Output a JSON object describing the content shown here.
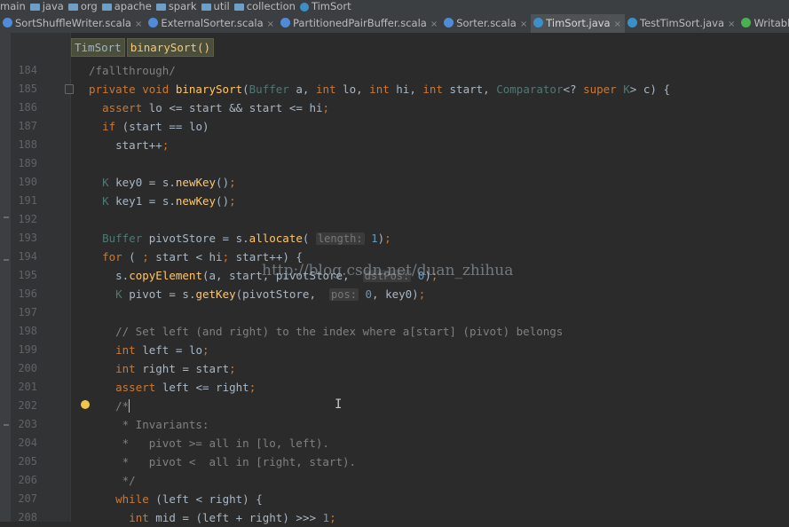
{
  "breadcrumbs": [
    "main",
    "java",
    "org",
    "apache",
    "spark",
    "util",
    "collection",
    "TimSort"
  ],
  "tabs": [
    {
      "label": "SortShuffleWriter.scala",
      "color": "#4f8bd6",
      "active": false
    },
    {
      "label": "ExternalSorter.scala",
      "color": "#4f8bd6",
      "active": false
    },
    {
      "label": "PartitionedPairBuffer.scala",
      "color": "#4f8bd6",
      "active": false
    },
    {
      "label": "Sorter.scala",
      "color": "#4f8bd6",
      "active": false
    },
    {
      "label": "TimSort.java",
      "color": "#3d8fc9",
      "active": true
    },
    {
      "label": "TestTimSort.java",
      "color": "#3d8fc9",
      "active": false
    },
    {
      "label": "WritablePa",
      "color": "#4caf50",
      "active": false
    }
  ],
  "tab_close_glyph": "×",
  "code_breadcrumb": {
    "class_name": "TimSort",
    "method_name": "binarySort()"
  },
  "watermark": "http://blog.csdn.net/duan_zhihua",
  "ibeam_glyph": "I",
  "lines": [
    {
      "num": "184",
      "text": "/fallthrough/"
    },
    {
      "num": "185",
      "text": "private void binarySort(Buffer a, int lo, int hi, int start, Comparator<? super K> c) {"
    },
    {
      "num": "186",
      "text": "  assert lo <= start && start <= hi;"
    },
    {
      "num": "187",
      "text": "  if (start == lo)"
    },
    {
      "num": "188",
      "text": "    start++;"
    },
    {
      "num": "189",
      "text": ""
    },
    {
      "num": "190",
      "text": "  K key0 = s.newKey();"
    },
    {
      "num": "191",
      "text": "  K key1 = s.newKey();"
    },
    {
      "num": "192",
      "text": ""
    },
    {
      "num": "193",
      "text": "  Buffer pivotStore = s.allocate( length: 1);"
    },
    {
      "num": "194",
      "text": "  for ( ; start < hi; start++) {"
    },
    {
      "num": "195",
      "text": "    s.copyElement(a, start, pivotStore,  dstPos: 0);"
    },
    {
      "num": "196",
      "text": "    K pivot = s.getKey(pivotStore,  pos: 0, key0);"
    },
    {
      "num": "197",
      "text": ""
    },
    {
      "num": "198",
      "text": "    // Set left (and right) to the index where a[start] (pivot) belongs"
    },
    {
      "num": "199",
      "text": "    int left = lo;"
    },
    {
      "num": "200",
      "text": "    int right = start;"
    },
    {
      "num": "201",
      "text": "    assert left <= right;"
    },
    {
      "num": "202",
      "text": "    /*"
    },
    {
      "num": "203",
      "text": "     * Invariants:"
    },
    {
      "num": "204",
      "text": "     *   pivot >= all in [lo, left)."
    },
    {
      "num": "205",
      "text": "     *   pivot <  all in [right, start)."
    },
    {
      "num": "206",
      "text": "     */"
    },
    {
      "num": "207",
      "text": "    while (left < right) {"
    },
    {
      "num": "208",
      "text": "      int mid = (left + right) >>> 1;"
    }
  ]
}
